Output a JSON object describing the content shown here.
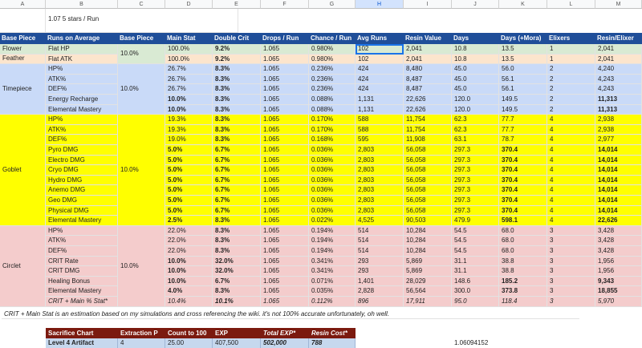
{
  "columns": [
    "A",
    "B",
    "C",
    "D",
    "E",
    "F",
    "G",
    "H",
    "I",
    "J",
    "K",
    "L",
    "M"
  ],
  "colors": {
    "header": "#1f4e99",
    "flower": "#d9ead3",
    "feather": "#fce5cd",
    "timepiece": "#c9daf8",
    "goblet": "#ffff00",
    "circlet": "#f4cccc",
    "sacrifice_header": "#7b1a0f",
    "sacrifice_row": "#c6d8ee"
  },
  "top_note": "1.07 5 stars / Run",
  "headers": [
    "Base Piece",
    "Runs on Average",
    "Base Piece",
    "Main Stat",
    "Double Crit",
    "Drops / Run",
    "Chance / Run",
    "Avg Runs",
    "Resin Value",
    "Days",
    "Days (+Mora)",
    "Elixers",
    "Resin/Elixer"
  ],
  "groups": [
    {
      "name": "Flower",
      "base": "",
      "color": "#d9ead3",
      "rows": [
        {
          "name": "Flat HP",
          "main": "100.0%",
          "mainB": false,
          "dc": "9.2%",
          "drops": "1.065",
          "chance": "0.980%",
          "avg": "102",
          "resin": "2,041",
          "days": "10.8",
          "daysM": "13.5",
          "daysMB": false,
          "elix": "1",
          "rpe": "2,041",
          "rpeB": false
        }
      ]
    },
    {
      "name": "Feather",
      "base": "",
      "color": "#fce5cd",
      "rows": [
        {
          "name": "Flat ATK",
          "main": "100.0%",
          "mainB": false,
          "dc": "9.2%",
          "drops": "1.065",
          "chance": "0.980%",
          "avg": "102",
          "resin": "2,041",
          "days": "10.8",
          "daysM": "13.5",
          "daysMB": false,
          "elix": "1",
          "rpe": "2,041",
          "rpeB": false
        }
      ]
    },
    {
      "name": "Timepiece",
      "base": "10.0%",
      "color": "#c9daf8",
      "rows": [
        {
          "name": "HP%",
          "main": "26.7%",
          "mainB": false,
          "dc": "8.3%",
          "drops": "1.065",
          "chance": "0.236%",
          "avg": "424",
          "resin": "8,480",
          "days": "45.0",
          "daysM": "56.0",
          "daysMB": false,
          "elix": "2",
          "rpe": "4,240",
          "rpeB": false
        },
        {
          "name": "ATK%",
          "main": "26.7%",
          "mainB": false,
          "dc": "8.3%",
          "drops": "1.065",
          "chance": "0.236%",
          "avg": "424",
          "resin": "8,487",
          "days": "45.0",
          "daysM": "56.1",
          "daysMB": false,
          "elix": "2",
          "rpe": "4,243",
          "rpeB": false
        },
        {
          "name": "DEF%",
          "main": "26.7%",
          "mainB": false,
          "dc": "8.3%",
          "drops": "1.065",
          "chance": "0.236%",
          "avg": "424",
          "resin": "8,487",
          "days": "45.0",
          "daysM": "56.1",
          "daysMB": false,
          "elix": "2",
          "rpe": "4,243",
          "rpeB": false
        },
        {
          "name": "Energy Recharge",
          "main": "10.0%",
          "mainB": true,
          "dc": "8.3%",
          "drops": "1.065",
          "chance": "0.088%",
          "avg": "1,131",
          "resin": "22,626",
          "days": "120.0",
          "daysM": "149.5",
          "daysMB": false,
          "elix": "2",
          "rpe": "11,313",
          "rpeB": true
        },
        {
          "name": "Elemental Mastery",
          "main": "10.0%",
          "mainB": true,
          "dc": "8.3%",
          "drops": "1.065",
          "chance": "0.088%",
          "avg": "1,131",
          "resin": "22,626",
          "days": "120.0",
          "daysM": "149.5",
          "daysMB": false,
          "elix": "2",
          "rpe": "11,313",
          "rpeB": true
        }
      ]
    },
    {
      "name": "Goblet",
      "base": "10.0%",
      "color": "#ffff00",
      "rows": [
        {
          "name": "HP%",
          "main": "19.3%",
          "mainB": false,
          "dc": "8.3%",
          "drops": "1.065",
          "chance": "0.170%",
          "avg": "588",
          "resin": "11,754",
          "days": "62.3",
          "daysM": "77.7",
          "daysMB": false,
          "elix": "4",
          "rpe": "2,938",
          "rpeB": false
        },
        {
          "name": "ATK%",
          "main": "19.3%",
          "mainB": false,
          "dc": "8.3%",
          "drops": "1.065",
          "chance": "0.170%",
          "avg": "588",
          "resin": "11,754",
          "days": "62.3",
          "daysM": "77.7",
          "daysMB": false,
          "elix": "4",
          "rpe": "2,938",
          "rpeB": false
        },
        {
          "name": "DEF%",
          "main": "19.0%",
          "mainB": false,
          "dc": "8.3%",
          "drops": "1.065",
          "chance": "0.168%",
          "avg": "595",
          "resin": "11,908",
          "days": "63.1",
          "daysM": "78.7",
          "daysMB": false,
          "elix": "4",
          "rpe": "2,977",
          "rpeB": false
        },
        {
          "name": "Pyro DMG",
          "main": "5.0%",
          "mainB": true,
          "dc": "6.7%",
          "drops": "1.065",
          "chance": "0.036%",
          "avg": "2,803",
          "resin": "56,058",
          "days": "297.3",
          "daysM": "370.4",
          "daysMB": true,
          "elix": "4",
          "rpe": "14,014",
          "rpeB": true
        },
        {
          "name": "Electro DMG",
          "main": "5.0%",
          "mainB": true,
          "dc": "6.7%",
          "drops": "1.065",
          "chance": "0.036%",
          "avg": "2,803",
          "resin": "56,058",
          "days": "297.3",
          "daysM": "370.4",
          "daysMB": true,
          "elix": "4",
          "rpe": "14,014",
          "rpeB": true
        },
        {
          "name": "Cryo DMG",
          "main": "5.0%",
          "mainB": true,
          "dc": "6.7%",
          "drops": "1.065",
          "chance": "0.036%",
          "avg": "2,803",
          "resin": "56,058",
          "days": "297.3",
          "daysM": "370.4",
          "daysMB": true,
          "elix": "4",
          "rpe": "14,014",
          "rpeB": true
        },
        {
          "name": "Hydro DMG",
          "main": "5.0%",
          "mainB": true,
          "dc": "6.7%",
          "drops": "1.065",
          "chance": "0.036%",
          "avg": "2,803",
          "resin": "56,058",
          "days": "297.3",
          "daysM": "370.4",
          "daysMB": true,
          "elix": "4",
          "rpe": "14,014",
          "rpeB": true
        },
        {
          "name": "Anemo DMG",
          "main": "5.0%",
          "mainB": true,
          "dc": "6.7%",
          "drops": "1.065",
          "chance": "0.036%",
          "avg": "2,803",
          "resin": "56,058",
          "days": "297.3",
          "daysM": "370.4",
          "daysMB": true,
          "elix": "4",
          "rpe": "14,014",
          "rpeB": true
        },
        {
          "name": "Geo DMG",
          "main": "5.0%",
          "mainB": true,
          "dc": "6.7%",
          "drops": "1.065",
          "chance": "0.036%",
          "avg": "2,803",
          "resin": "56,058",
          "days": "297.3",
          "daysM": "370.4",
          "daysMB": true,
          "elix": "4",
          "rpe": "14,014",
          "rpeB": true
        },
        {
          "name": "Physical DMG",
          "main": "5.0%",
          "mainB": true,
          "dc": "6.7%",
          "drops": "1.065",
          "chance": "0.036%",
          "avg": "2,803",
          "resin": "56,058",
          "days": "297.3",
          "daysM": "370.4",
          "daysMB": true,
          "elix": "4",
          "rpe": "14,014",
          "rpeB": true
        },
        {
          "name": "Elemental Mastery",
          "main": "2.5%",
          "mainB": true,
          "dc": "8.3%",
          "drops": "1.065",
          "chance": "0.022%",
          "avg": "4,525",
          "resin": "90,503",
          "days": "479.9",
          "daysM": "598.1",
          "daysMB": true,
          "elix": "4",
          "rpe": "22,626",
          "rpeB": true
        }
      ]
    },
    {
      "name": "Circlet",
      "base": "10.0%",
      "color": "#f4cccc",
      "rows": [
        {
          "name": "HP%",
          "main": "22.0%",
          "mainB": false,
          "dc": "8.3%",
          "drops": "1.065",
          "chance": "0.194%",
          "avg": "514",
          "resin": "10,284",
          "days": "54.5",
          "daysM": "68.0",
          "daysMB": false,
          "elix": "3",
          "rpe": "3,428",
          "rpeB": false
        },
        {
          "name": "ATK%",
          "main": "22.0%",
          "mainB": false,
          "dc": "8.3%",
          "drops": "1.065",
          "chance": "0.194%",
          "avg": "514",
          "resin": "10,284",
          "days": "54.5",
          "daysM": "68.0",
          "daysMB": false,
          "elix": "3",
          "rpe": "3,428",
          "rpeB": false
        },
        {
          "name": "DEF%",
          "main": "22.0%",
          "mainB": false,
          "dc": "8.3%",
          "drops": "1.065",
          "chance": "0.194%",
          "avg": "514",
          "resin": "10,284",
          "days": "54.5",
          "daysM": "68.0",
          "daysMB": false,
          "elix": "3",
          "rpe": "3,428",
          "rpeB": false
        },
        {
          "name": "CRIT Rate",
          "main": "10.0%",
          "mainB": true,
          "dc": "32.0%",
          "drops": "1.065",
          "chance": "0.341%",
          "avg": "293",
          "resin": "5,869",
          "days": "31.1",
          "daysM": "38.8",
          "daysMB": false,
          "elix": "3",
          "rpe": "1,956",
          "rpeB": false
        },
        {
          "name": "CRIT DMG",
          "main": "10.0%",
          "mainB": true,
          "dc": "32.0%",
          "drops": "1.065",
          "chance": "0.341%",
          "avg": "293",
          "resin": "5,869",
          "days": "31.1",
          "daysM": "38.8",
          "daysMB": false,
          "elix": "3",
          "rpe": "1,956",
          "rpeB": false
        },
        {
          "name": "Healing Bonus",
          "main": "10.0%",
          "mainB": true,
          "dc": "6.7%",
          "drops": "1.065",
          "chance": "0.071%",
          "avg": "1,401",
          "resin": "28,029",
          "days": "148.6",
          "daysM": "185.2",
          "daysMB": true,
          "elix": "3",
          "rpe": "9,343",
          "rpeB": true
        },
        {
          "name": "Elemental Mastery",
          "main": "4.0%",
          "mainB": true,
          "dc": "8.3%",
          "drops": "1.065",
          "chance": "0.035%",
          "avg": "2,828",
          "resin": "56,564",
          "days": "300.0",
          "daysM": "373.8",
          "daysMB": true,
          "elix": "3",
          "rpe": "18,855",
          "rpeB": true
        },
        {
          "name": "CRIT + Main % Stat*",
          "main": "10.4%",
          "mainB": false,
          "dc": "10.1%",
          "drops": "1.065",
          "chance": "0.112%",
          "avg": "896",
          "resin": "17,911",
          "days": "95.0",
          "daysM": "118.4",
          "daysMB": false,
          "elix": "3",
          "rpe": "5,970",
          "rpeB": false,
          "italic": true
        }
      ]
    }
  ],
  "footnote": "CRIT + Main Stat is an estimation based on my simulations and cross referencing the wiki. it's not 100% accurate unfortunately, oh well.",
  "sacrifice": {
    "headers": [
      "Sacrifice Chart",
      "Extraction P",
      "Count to 100",
      "EXP",
      "Total EXP*",
      "Resin Cost*"
    ],
    "row": [
      "Level 4 Artifact",
      "4",
      "25.00",
      "407,500",
      "502,000",
      "788"
    ]
  },
  "stray_value": "1.06094152",
  "selected_cell": {
    "name": "Flat HP",
    "column": "H"
  }
}
